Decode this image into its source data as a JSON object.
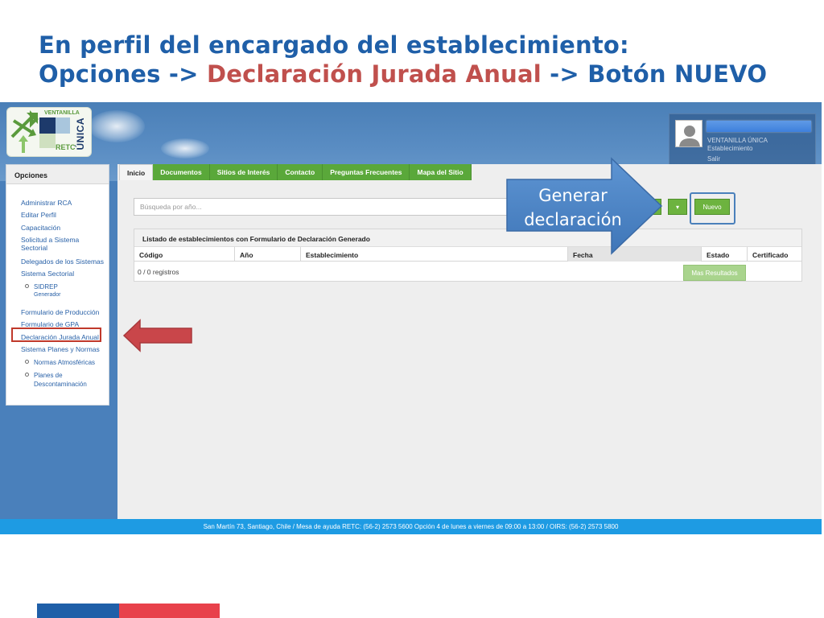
{
  "slide": {
    "title_line1": "En perfil del encargado del establecimiento:",
    "title_line2_a": "Opciones ->",
    "title_line2_b": "Declaración Jurada Anual",
    "title_line2_c": "-> Botón NUEVO"
  },
  "logo": {
    "top_text": "VENTANILLA",
    "unica": "ÚNICA",
    "retc": "RETC"
  },
  "user": {
    "line1": "VENTANILLA ÚNICA",
    "line2": "Establecimiento",
    "logout": "Salir"
  },
  "sidebar": {
    "header": "Opciones",
    "items": [
      "Administrar RCA",
      "Editar Perfil",
      "Capacitación",
      "Solicitud a Sistema Sectorial",
      "Delegados de los Sistemas",
      "Sistema Sectorial",
      "Formulario de Producción",
      "Formulario de GPA",
      "Declaración Jurada Anual",
      "Sistema Planes y Normas"
    ],
    "sectorial_sub": {
      "label": "SIDREP",
      "small": "Generador"
    },
    "planes_sub": [
      "Normas Atmosféricas",
      "Planes de Descontaminación"
    ]
  },
  "tabs": [
    "Inicio",
    "Documentos",
    "Sitios de Interés",
    "Contacto",
    "Preguntas Frecuentes",
    "Mapa del Sitio"
  ],
  "search": {
    "placeholder": "Búsqueda por año..."
  },
  "buttons": {
    "nuevo": "Nuevo",
    "dropdown": "▾",
    "more_results": "Mas Resultados"
  },
  "table": {
    "title": "Listado de establecimientos con Formulario de Declaración Generado",
    "columns": [
      "Código",
      "Año",
      "Establecimiento",
      "Fecha",
      "Estado",
      "Certificado"
    ],
    "records": "0 / 0 registros"
  },
  "footer": {
    "text": "San Martín 73, Santiago, Chile / Mesa de ayuda RETC: (56-2) 2573 5600 Opción 4 de lunes a viernes de 09:00 a 13:00 / OIRS: (56-2) 2573 5800"
  },
  "callout": {
    "line1": "Generar",
    "line2": "declaración"
  },
  "colors": {
    "title_blue": "#1f5fa8",
    "title_red": "#c0504d",
    "tab_green": "#5aa83a",
    "footer_blue": "#1e9be3",
    "callout_blue": "#4f86c6",
    "highlight_red": "#c0392b"
  }
}
